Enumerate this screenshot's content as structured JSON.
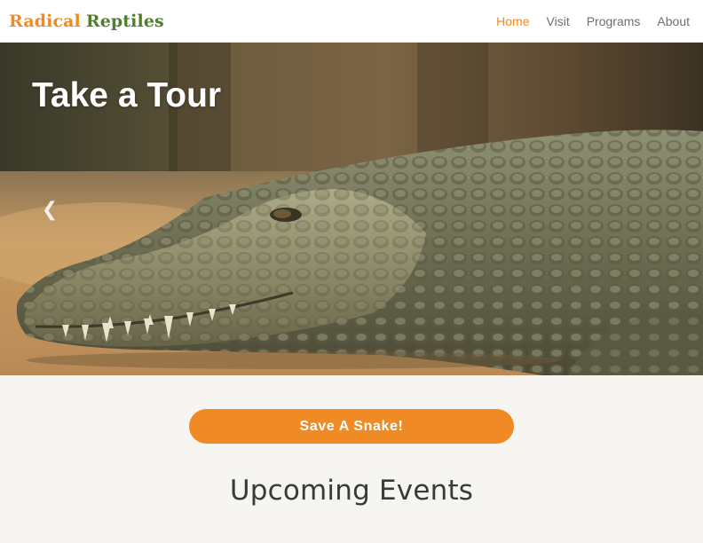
{
  "brand": {
    "word1": "Radical",
    "word2": "Reptiles",
    "color_primary": "#f08a24",
    "color_secondary": "#4f7f2a"
  },
  "nav": {
    "items": [
      {
        "label": "Home",
        "active": true
      },
      {
        "label": "Visit",
        "active": false
      },
      {
        "label": "Programs",
        "active": false
      },
      {
        "label": "About",
        "active": false
      }
    ]
  },
  "hero": {
    "title": "Take a Tour",
    "prev_icon": "chevron-left-icon",
    "image": "crocodile-photo"
  },
  "cta": {
    "label": "Save A Snake!",
    "color": "#f08a24"
  },
  "events": {
    "heading": "Upcoming Events"
  }
}
